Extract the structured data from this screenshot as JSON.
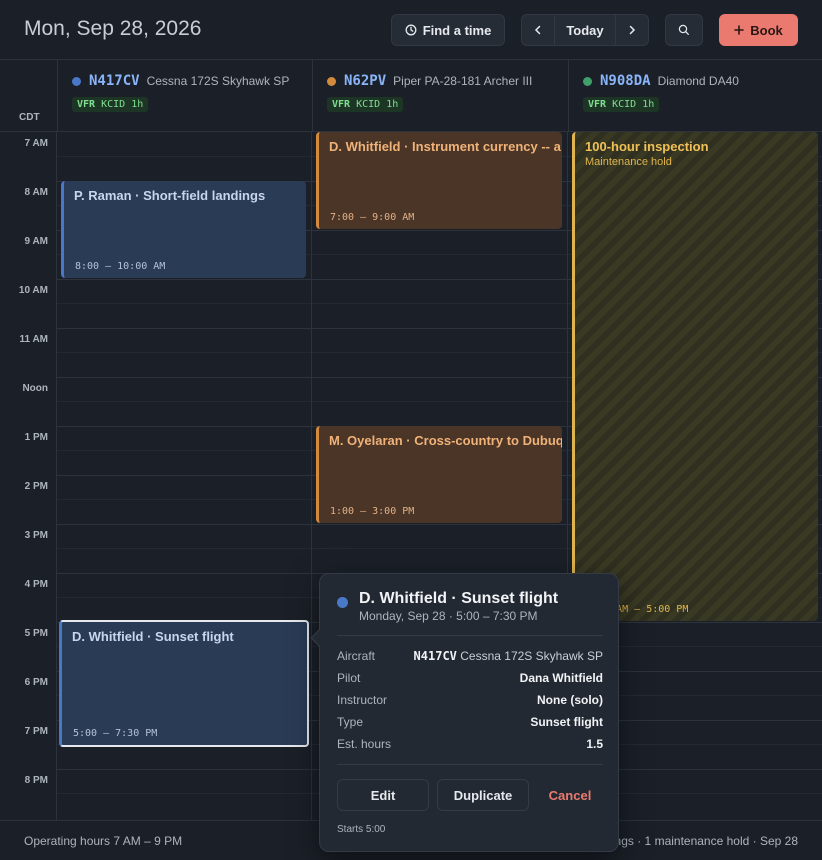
{
  "header": {
    "date_title": "Mon, Sep 28, 2026",
    "find_time_label": "Find a time",
    "today_label": "Today",
    "book_label": "Book"
  },
  "timezone": "CDT",
  "aircraft": [
    {
      "tail": "N417CV",
      "model": "Cessna 172S Skyhawk SP",
      "color": "#4a78c8",
      "rules": "VFR",
      "airport": "KCID",
      "duration": "1h"
    },
    {
      "tail": "N62PV",
      "model": "Piper PA-28-181 Archer III",
      "color": "#d48a3c",
      "rules": "VFR",
      "airport": "KCID",
      "duration": "1h"
    },
    {
      "tail": "N908DA",
      "model": "Diamond DA40",
      "color": "#3fa06a",
      "rules": "VFR",
      "airport": "KCID",
      "duration": "1h"
    }
  ],
  "time_labels": [
    "7 AM",
    "8 AM",
    "9 AM",
    "10 AM",
    "11 AM",
    "Noon",
    "1 PM",
    "2 PM",
    "3 PM",
    "4 PM",
    "5 PM",
    "6 PM",
    "7 PM",
    "8 PM"
  ],
  "events": [
    {
      "title": "P. Raman · Short-field landings",
      "time": "8:00 – 10:00 AM"
    },
    {
      "title": "D. Whitfield · Instrument currency -- a",
      "time": "7:00 – 9:00 AM"
    },
    {
      "title": "100-hour inspection",
      "subtitle": "Maintenance hold",
      "time": "7:00 AM – 5:00 PM"
    },
    {
      "title": "M. Oyelaran · Cross-country to Dubuq",
      "time": "1:00 – 3:00 PM"
    },
    {
      "title": "D. Whitfield · Sunset flight",
      "time": "5:00 – 7:30 PM"
    }
  ],
  "popover": {
    "title": "D. Whitfield · Sunset flight",
    "subtitle": "Monday, Sep 28 · 5:00 – 7:30 PM",
    "rows": [
      {
        "key": "Aircraft",
        "value_bold": "N417CV",
        "value_light": "Cessna 172S Skyhawk SP"
      },
      {
        "key": "Pilot",
        "value": "Dana Whitfield"
      },
      {
        "key": "Instructor",
        "value": "None (solo)"
      },
      {
        "key": "Type",
        "value": "Sunset flight"
      },
      {
        "key": "Est. hours",
        "value": "1.5"
      }
    ],
    "edit_label": "Edit",
    "duplicate_label": "Duplicate",
    "cancel_label": "Cancel",
    "footer": "Starts 5:00"
  },
  "footer": {
    "left": "Operating hours 7 AM – 9 PM",
    "right": "ngs · 1 maintenance hold · Sep 28"
  }
}
